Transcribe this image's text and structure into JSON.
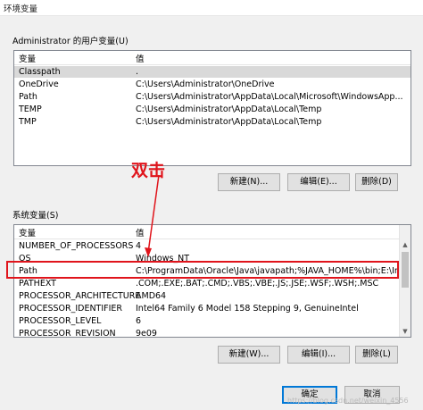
{
  "window": {
    "title": "环境变量"
  },
  "user_vars": {
    "group_label": "Administrator 的用户变量(U)",
    "columns": [
      "变量",
      "值"
    ],
    "rows": [
      {
        "name": "Classpath",
        "value": "."
      },
      {
        "name": "OneDrive",
        "value": "C:\\Users\\Administrator\\OneDrive"
      },
      {
        "name": "Path",
        "value": "C:\\Users\\Administrator\\AppData\\Local\\Microsoft\\WindowsApp..."
      },
      {
        "name": "TEMP",
        "value": "C:\\Users\\Administrator\\AppData\\Local\\Temp"
      },
      {
        "name": "TMP",
        "value": "C:\\Users\\Administrator\\AppData\\Local\\Temp"
      }
    ],
    "buttons": {
      "new": "新建(N)...",
      "edit": "编辑(E)...",
      "delete": "删除(D)"
    }
  },
  "system_vars": {
    "group_label": "系统变量(S)",
    "columns": [
      "变量",
      "值"
    ],
    "rows": [
      {
        "name": "NUMBER_OF_PROCESSORS",
        "value": "4"
      },
      {
        "name": "OS",
        "value": "Windows_NT"
      },
      {
        "name": "Path",
        "value": "C:\\ProgramData\\Oracle\\Java\\javapath;%JAVA_HOME%\\bin;E:\\In..."
      },
      {
        "name": "PATHEXT",
        "value": ".COM;.EXE;.BAT;.CMD;.VBS;.VBE;.JS;.JSE;.WSF;.WSH;.MSC"
      },
      {
        "name": "PROCESSOR_ARCHITECTURE",
        "value": "AMD64"
      },
      {
        "name": "PROCESSOR_IDENTIFIER",
        "value": "Intel64 Family 6 Model 158 Stepping 9, GenuineIntel"
      },
      {
        "name": "PROCESSOR_LEVEL",
        "value": "6"
      },
      {
        "name": "PROCESSOR_REVISION",
        "value": "9e09"
      }
    ],
    "buttons": {
      "new": "新建(W)...",
      "edit": "编辑(I)...",
      "delete": "删除(L)"
    }
  },
  "footer": {
    "ok": "确定",
    "cancel": "取消"
  },
  "annotation": {
    "text": "双击",
    "color": "#e0141b"
  },
  "watermark": "https://blog.csdn.net/weixin_4556"
}
